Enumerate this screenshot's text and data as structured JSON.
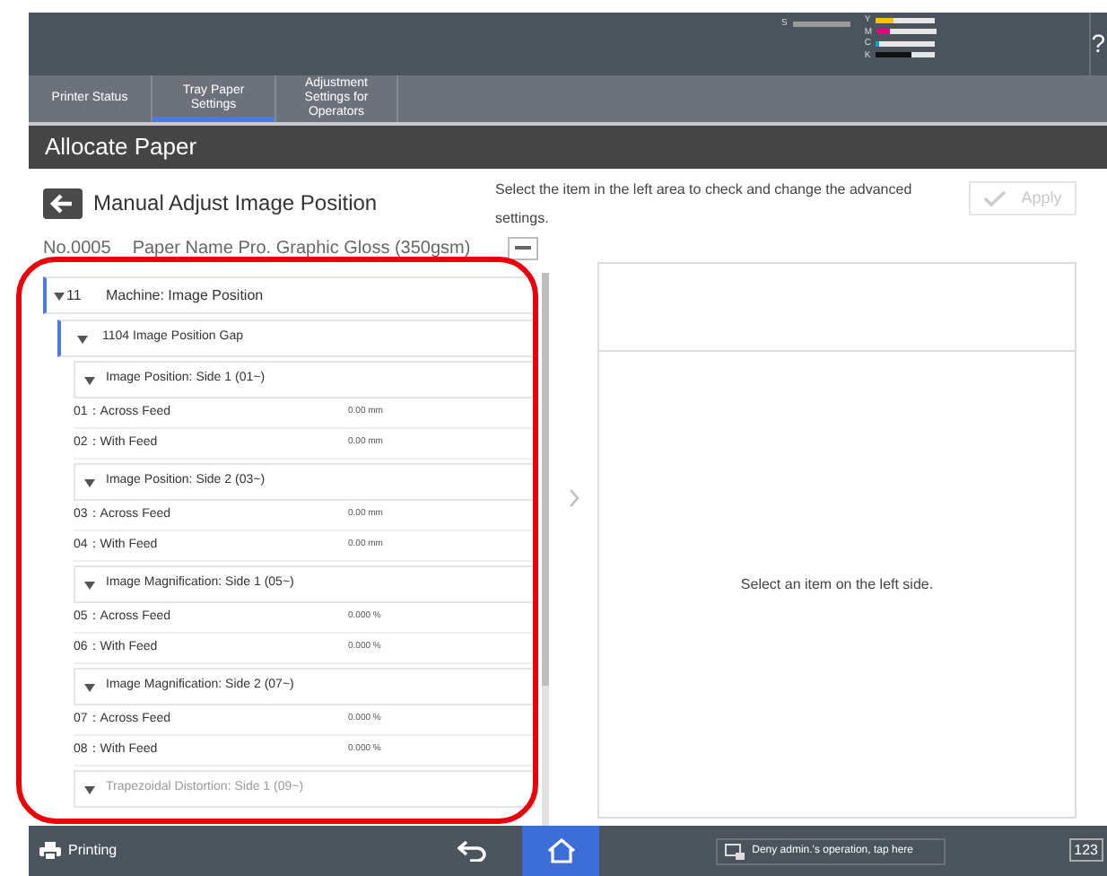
{
  "status_bar": {
    "supplies": [
      {
        "label": "S",
        "level": 1.0,
        "color": "#9a9a9a"
      },
      {
        "label": "Y",
        "level": 0.3,
        "color": "#f5c400"
      },
      {
        "label": "M",
        "level": 0.2,
        "color": "#e6007e"
      },
      {
        "label": "C",
        "level": 0.06,
        "color": "#00a0e0"
      },
      {
        "label": "K",
        "level": 0.6,
        "color": "#111111"
      }
    ],
    "help": "?"
  },
  "tabs": [
    {
      "label": "Printer Status",
      "selected": false
    },
    {
      "label": "Tray Paper Settings",
      "selected": true
    },
    {
      "label": "Adjustment Settings for Operators",
      "selected": false
    }
  ],
  "section_title": "Allocate Paper",
  "page_title": "Manual Adjust Image Position",
  "instruction": "Select the item in the left area to check and change the advanced settings.",
  "apply_button": {
    "label": "Apply",
    "disabled": true
  },
  "paper": {
    "number": "No.0005",
    "name": "Paper Name Pro. Graphic Gloss (350gsm)"
  },
  "tree": [
    {
      "label": "Machine: Image Position",
      "code": "11",
      "expanded": true,
      "children": [
        {
          "label": "1104 Image Position Gap",
          "expanded": true,
          "children": [
            {
              "label": "Image Position: Side 1 (01~)",
              "expanded": true,
              "items": [
                {
                  "label": "01：Across Feed",
                  "value": "0.00 mm"
                },
                {
                  "label": "02：With Feed",
                  "value": "0.00 mm"
                }
              ]
            },
            {
              "label": "Image Position: Side 2 (03~)",
              "expanded": true,
              "items": [
                {
                  "label": "03：Across Feed",
                  "value": "0.00 mm"
                },
                {
                  "label": "04：With Feed",
                  "value": "0.00 mm"
                }
              ]
            },
            {
              "label": "Image Magnification: Side 1 (05~)",
              "expanded": true,
              "items": [
                {
                  "label": "05：Across Feed",
                  "value": "0.000 %"
                },
                {
                  "label": "06：With Feed",
                  "value": "0.000 %"
                }
              ]
            },
            {
              "label": "Image Magnification: Side 2 (07~)",
              "expanded": true,
              "items": [
                {
                  "label": "07：Across Feed",
                  "value": "0.000 %"
                },
                {
                  "label": "08：With Feed",
                  "value": "0.000 %"
                }
              ]
            },
            {
              "label": "Trapezoidal Distortion: Side 1 (09~)",
              "expanded": true
            }
          ]
        }
      ]
    }
  ],
  "detail_message": "Select an item on the left side.",
  "bottom_bar": {
    "status": "Printing",
    "notice": "Deny admin.'s operation, tap here",
    "keypad": "123"
  }
}
